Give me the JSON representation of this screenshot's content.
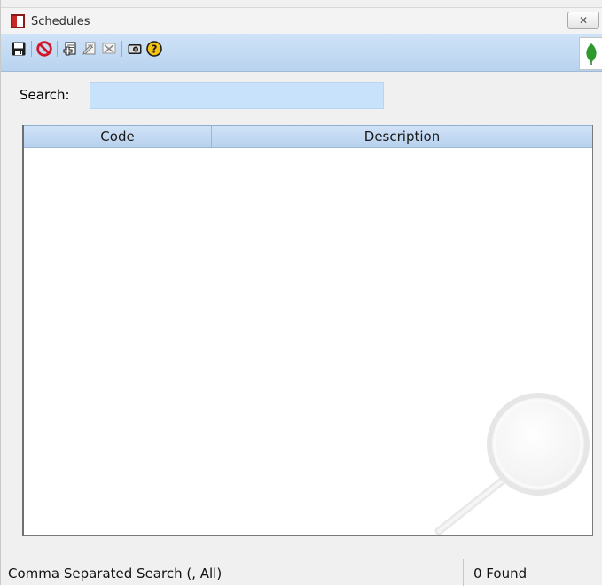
{
  "window": {
    "title": "Schedules",
    "close_glyph": "✕"
  },
  "toolbar": {
    "buttons": [
      {
        "name": "save-icon"
      },
      {
        "name": "cancel-icon"
      },
      {
        "name": "add-record-icon"
      },
      {
        "name": "edit-record-icon"
      },
      {
        "name": "delete-record-icon"
      },
      {
        "name": "camera-icon"
      },
      {
        "name": "help-icon"
      }
    ],
    "logo": "leaf-icon"
  },
  "search": {
    "label": "Search:",
    "value": "",
    "placeholder": ""
  },
  "grid": {
    "columns": [
      "Code",
      "Description"
    ],
    "rows": [],
    "watermark": "magnifier-icon"
  },
  "status": {
    "hint": "Comma Separated Search (, All)",
    "count": "0 Found"
  },
  "colors": {
    "toolbar": "#c4dbf3",
    "search_field": "#c9e2fc",
    "grid_header": "#c4daf2"
  }
}
